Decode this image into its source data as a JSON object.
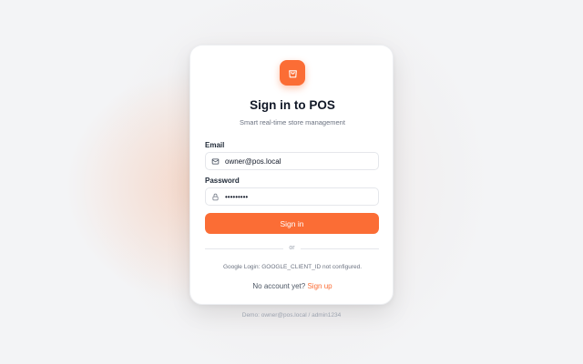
{
  "brand": {
    "accent": "#fb6d35",
    "logo_icon": "shopping-bag-icon"
  },
  "title": "Sign in to POS",
  "subtitle": "Smart real-time store management",
  "form": {
    "email_label": "Email",
    "email_icon": "mail-icon",
    "email_value": "owner@pos.local",
    "password_label": "Password",
    "password_icon": "lock-icon",
    "password_value": "admin1234",
    "submit_label": "Sign in"
  },
  "divider_text": "or",
  "google_notice": "Google Login: GOOGLE_CLIENT_ID not configured.",
  "signup": {
    "prompt": "No account yet?",
    "link_label": "Sign up"
  },
  "demo_hint": "Demo: owner@pos.local / admin1234"
}
